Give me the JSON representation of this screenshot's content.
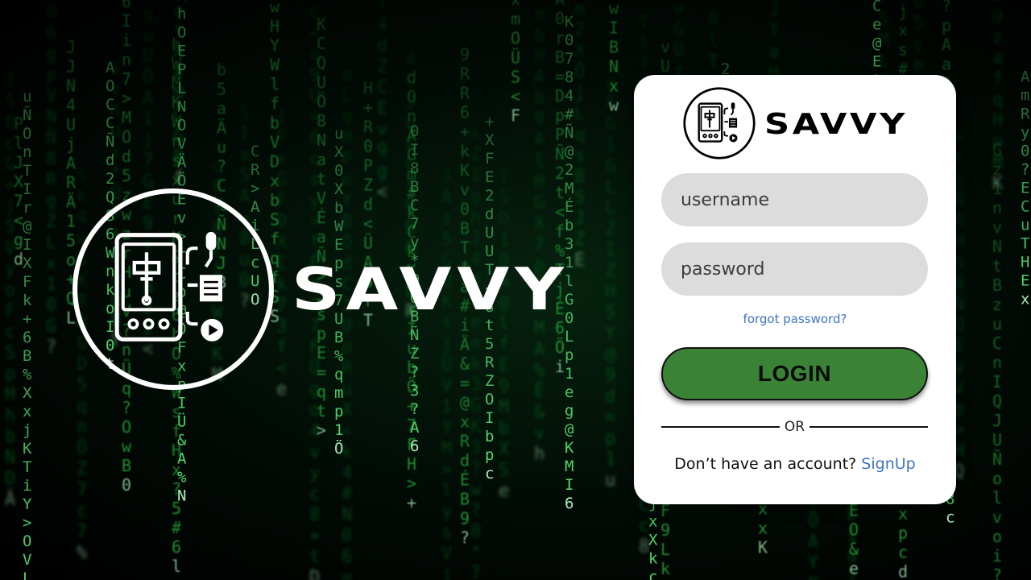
{
  "brand": {
    "name": "SAVVY"
  },
  "login": {
    "username_placeholder": "username",
    "password_placeholder": "password",
    "forgot_label": "forgot password?",
    "login_label": "LOGIN",
    "divider_label": "OR",
    "signup_prompt": "Don’t have an account? ",
    "signup_label": "SignUp"
  },
  "colors": {
    "background": "#000000",
    "matrix_green": "#2fd34a",
    "card": "#ffffff",
    "input_fill": "#dcdcdc",
    "button_green": "#3a8236",
    "link_blue": "#3d73c5"
  },
  "icons": {
    "logo": "phone-mixer-app-icon",
    "background": "matrix-code-rain"
  }
}
